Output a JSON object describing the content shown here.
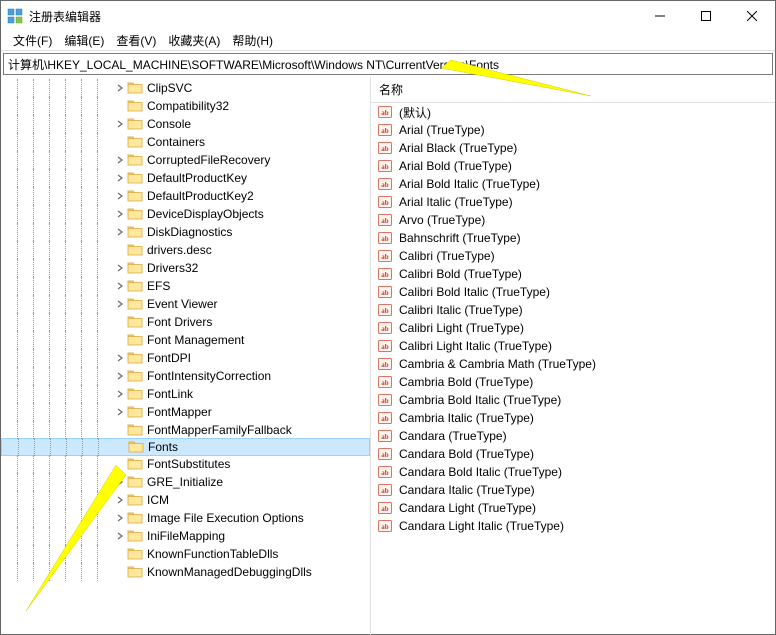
{
  "window": {
    "title": "注册表编辑器"
  },
  "menubar": {
    "items": [
      {
        "label": "文件(F)"
      },
      {
        "label": "编辑(E)"
      },
      {
        "label": "查看(V)"
      },
      {
        "label": "收藏夹(A)"
      },
      {
        "label": "帮助(H)"
      }
    ]
  },
  "addressbar": {
    "path": "计算机\\HKEY_LOCAL_MACHINE\\SOFTWARE\\Microsoft\\Windows NT\\CurrentVersion\\Fonts"
  },
  "tree": {
    "items": [
      {
        "label": "ClipSVC",
        "expandable": true
      },
      {
        "label": "Compatibility32",
        "expandable": false
      },
      {
        "label": "Console",
        "expandable": true
      },
      {
        "label": "Containers",
        "expandable": false
      },
      {
        "label": "CorruptedFileRecovery",
        "expandable": true
      },
      {
        "label": "DefaultProductKey",
        "expandable": true
      },
      {
        "label": "DefaultProductKey2",
        "expandable": true
      },
      {
        "label": "DeviceDisplayObjects",
        "expandable": true
      },
      {
        "label": "DiskDiagnostics",
        "expandable": true
      },
      {
        "label": "drivers.desc",
        "expandable": false
      },
      {
        "label": "Drivers32",
        "expandable": true
      },
      {
        "label": "EFS",
        "expandable": true
      },
      {
        "label": "Event Viewer",
        "expandable": true
      },
      {
        "label": "Font Drivers",
        "expandable": false
      },
      {
        "label": "Font Management",
        "expandable": false
      },
      {
        "label": "FontDPI",
        "expandable": true
      },
      {
        "label": "FontIntensityCorrection",
        "expandable": true
      },
      {
        "label": "FontLink",
        "expandable": true
      },
      {
        "label": "FontMapper",
        "expandable": true
      },
      {
        "label": "FontMapperFamilyFallback",
        "expandable": false
      },
      {
        "label": "Fonts",
        "expandable": false,
        "selected": true
      },
      {
        "label": "FontSubstitutes",
        "expandable": false
      },
      {
        "label": "GRE_Initialize",
        "expandable": true
      },
      {
        "label": "ICM",
        "expandable": true
      },
      {
        "label": "Image File Execution Options",
        "expandable": true
      },
      {
        "label": "IniFileMapping",
        "expandable": true
      },
      {
        "label": "KnownFunctionTableDlls",
        "expandable": false
      },
      {
        "label": "KnownManagedDebuggingDlls",
        "expandable": false
      }
    ]
  },
  "list": {
    "header": "名称",
    "items": [
      {
        "label": "(默认)"
      },
      {
        "label": "Arial (TrueType)"
      },
      {
        "label": "Arial Black (TrueType)"
      },
      {
        "label": "Arial Bold (TrueType)"
      },
      {
        "label": "Arial Bold Italic (TrueType)"
      },
      {
        "label": "Arial Italic (TrueType)"
      },
      {
        "label": "Arvo (TrueType)"
      },
      {
        "label": "Bahnschrift (TrueType)"
      },
      {
        "label": "Calibri (TrueType)"
      },
      {
        "label": "Calibri Bold (TrueType)"
      },
      {
        "label": "Calibri Bold Italic (TrueType)"
      },
      {
        "label": "Calibri Italic (TrueType)"
      },
      {
        "label": "Calibri Light (TrueType)"
      },
      {
        "label": "Calibri Light Italic (TrueType)"
      },
      {
        "label": "Cambria & Cambria Math (TrueType)"
      },
      {
        "label": "Cambria Bold (TrueType)"
      },
      {
        "label": "Cambria Bold Italic (TrueType)"
      },
      {
        "label": "Cambria Italic (TrueType)"
      },
      {
        "label": "Candara (TrueType)"
      },
      {
        "label": "Candara Bold (TrueType)"
      },
      {
        "label": "Candara Bold Italic (TrueType)"
      },
      {
        "label": "Candara Italic (TrueType)"
      },
      {
        "label": "Candara Light (TrueType)"
      },
      {
        "label": "Candara Light Italic (TrueType)"
      }
    ]
  }
}
